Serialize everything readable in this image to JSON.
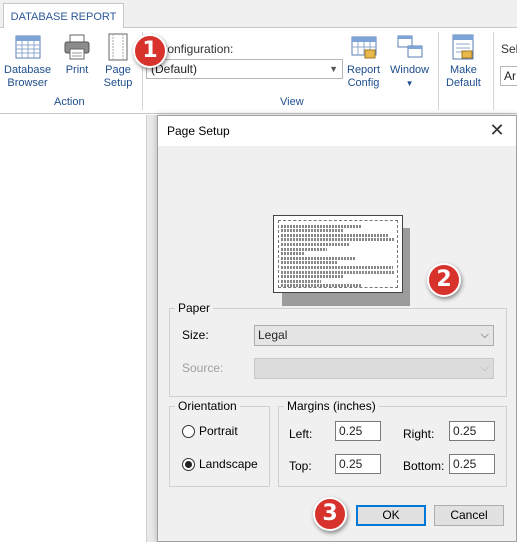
{
  "app": {
    "tab_label": "DATABASE REPORT"
  },
  "ribbon": {
    "database_browser_label_1": "Database",
    "database_browser_label_2": "Browser",
    "print_label": "Print",
    "page_setup_label_1": "Page",
    "page_setup_label_2": "Setup",
    "action_group_label": "Action",
    "select_config_label": "ct Configuration:",
    "select_config_value": "(Default)",
    "report_config_label_1": "Report",
    "report_config_label_2": "Config",
    "window_label": "Window",
    "view_group_label": "View",
    "make_default_label_1": "Make",
    "make_default_label_2": "Default",
    "partial_label": "Sel",
    "partial_combo_value": "Ar"
  },
  "dialog": {
    "title": "Page Setup",
    "paper_group": "Paper",
    "size_label": "Size:",
    "size_value": "Legal",
    "source_label": "Source:",
    "source_value": "",
    "orientation_group": "Orientation",
    "portrait_label": "Portrait",
    "landscape_label": "Landscape",
    "selected_orientation": "landscape",
    "margins_group": "Margins (inches)",
    "left_label": "Left:",
    "left_value": "0.25",
    "right_label": "Right:",
    "right_value": "0.25",
    "top_label": "Top:",
    "top_value": "0.25",
    "bottom_label": "Bottom:",
    "bottom_value": "0.25",
    "ok_label": "OK",
    "cancel_label": "Cancel"
  },
  "annotations": {
    "step1": "1",
    "step2": "2",
    "step3": "3",
    "badge_color": "#d8322d"
  },
  "colors": {
    "ribbon_text": "#1e4e8c",
    "tab_text": "#2b579a",
    "primary_focus": "#0078d7"
  }
}
